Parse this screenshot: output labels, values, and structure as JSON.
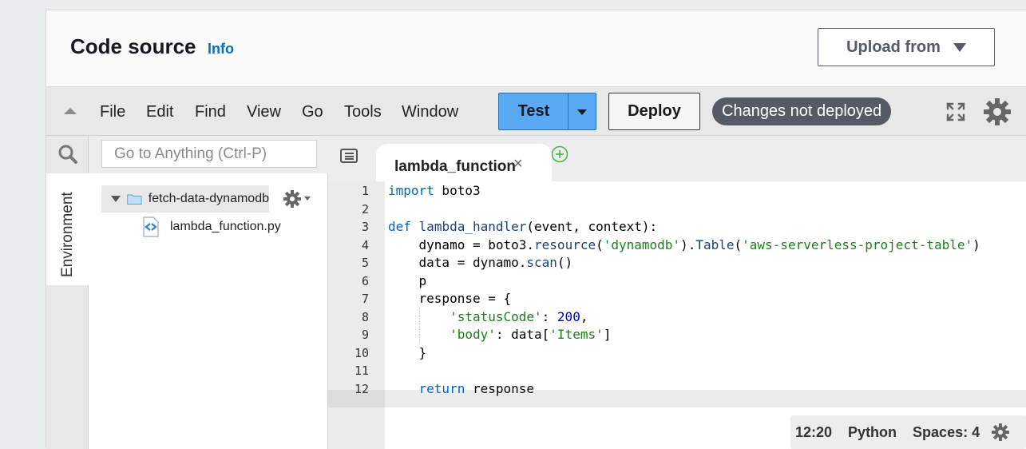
{
  "header": {
    "title": "Code source",
    "info_link": "Info",
    "upload_button": "Upload from"
  },
  "menu": {
    "items": [
      "File",
      "Edit",
      "Find",
      "View",
      "Go",
      "Tools",
      "Window"
    ],
    "test_button": "Test",
    "deploy_button": "Deploy",
    "status_badge": "Changes not deployed"
  },
  "sidebar": {
    "environment_tab": "Environment",
    "goto_placeholder": "Go to Anything (Ctrl-P)",
    "folder_name": "fetch-data-dynamodb",
    "file_name": "lambda_function.py"
  },
  "editor": {
    "active_tab": "lambda_function",
    "tab_close": "×",
    "line_numbers": [
      "1",
      "2",
      "3",
      "4",
      "5",
      "6",
      "7",
      "8",
      "9",
      "10",
      "11",
      "12"
    ],
    "code_lines": [
      "import boto3",
      "",
      "def lambda_handler(event, context):",
      "    dynamo = boto3.resource('dynamodb').Table('aws-serverless-project-table')",
      "    data = dynamo.scan()",
      "    p",
      "    response = {",
      "        'statusCode': 200,",
      "        'body': data['Items']",
      "    }",
      "",
      "    return response"
    ]
  },
  "statusbar": {
    "position": "12:20",
    "language": "Python",
    "spaces": "Spaces: 4"
  },
  "colors": {
    "test_button": "#5aa9f5",
    "badge": "#545b64",
    "link": "#0073bb",
    "keyword": "#0065c4",
    "string": "#1a7f1a",
    "number": "#0000cd"
  },
  "icons": [
    "collapse-icon",
    "fullscreen-icon",
    "settings-icon",
    "search-icon",
    "folder-icon",
    "python-file-icon",
    "gear-icon",
    "tab-list-icon",
    "add-tab-icon"
  ]
}
